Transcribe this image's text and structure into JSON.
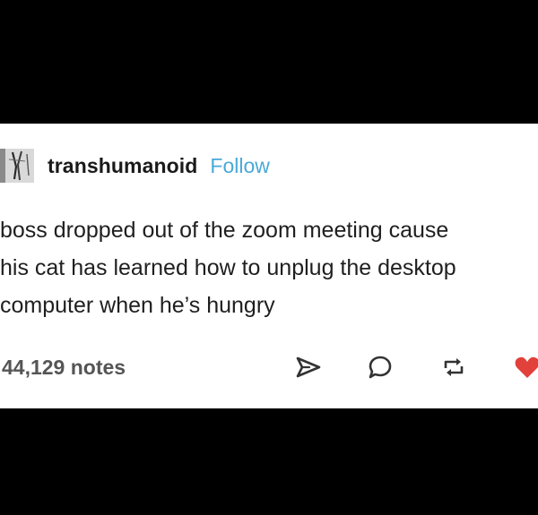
{
  "post": {
    "username": "transhumanoid",
    "follow_label": "Follow",
    "body": "boss dropped out of the zoom meeting cause\nhis cat has learned how to unplug the desktop\ncomputer when he’s hungry",
    "notes_label": "44,129 notes"
  },
  "colors": {
    "background": "#000000",
    "card": "#ffffff",
    "follow": "#4aa8d8",
    "like": "#e2403a",
    "icon": "#333333"
  },
  "icons": {
    "share": "share-icon",
    "reply": "reply-icon",
    "reblog": "reblog-icon",
    "like": "heart-icon"
  }
}
